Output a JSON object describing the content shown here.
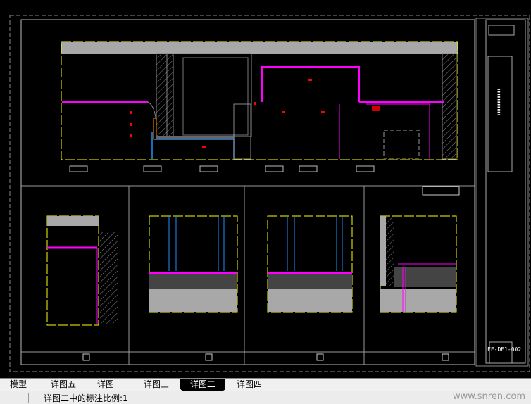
{
  "tabs": [
    {
      "label": "模型",
      "active": false
    },
    {
      "label": "详图五",
      "active": false
    },
    {
      "label": "详图一",
      "active": false
    },
    {
      "label": "详图三",
      "active": false
    },
    {
      "label": "详图二",
      "active": true
    },
    {
      "label": "详图四",
      "active": false
    }
  ],
  "status": {
    "message": "详图二中的标注比例:1",
    "watermark": "www.snren.com"
  },
  "title_block": {
    "drawing_number": "FF-DE1-002"
  },
  "colors": {
    "background": "#000000",
    "frame": "#ffff00",
    "finish": "#ff00ff",
    "glass": "#1e90ff",
    "dimension": "#ff0000",
    "concrete": "#a8a8a8",
    "line": "#c8c8c8"
  }
}
